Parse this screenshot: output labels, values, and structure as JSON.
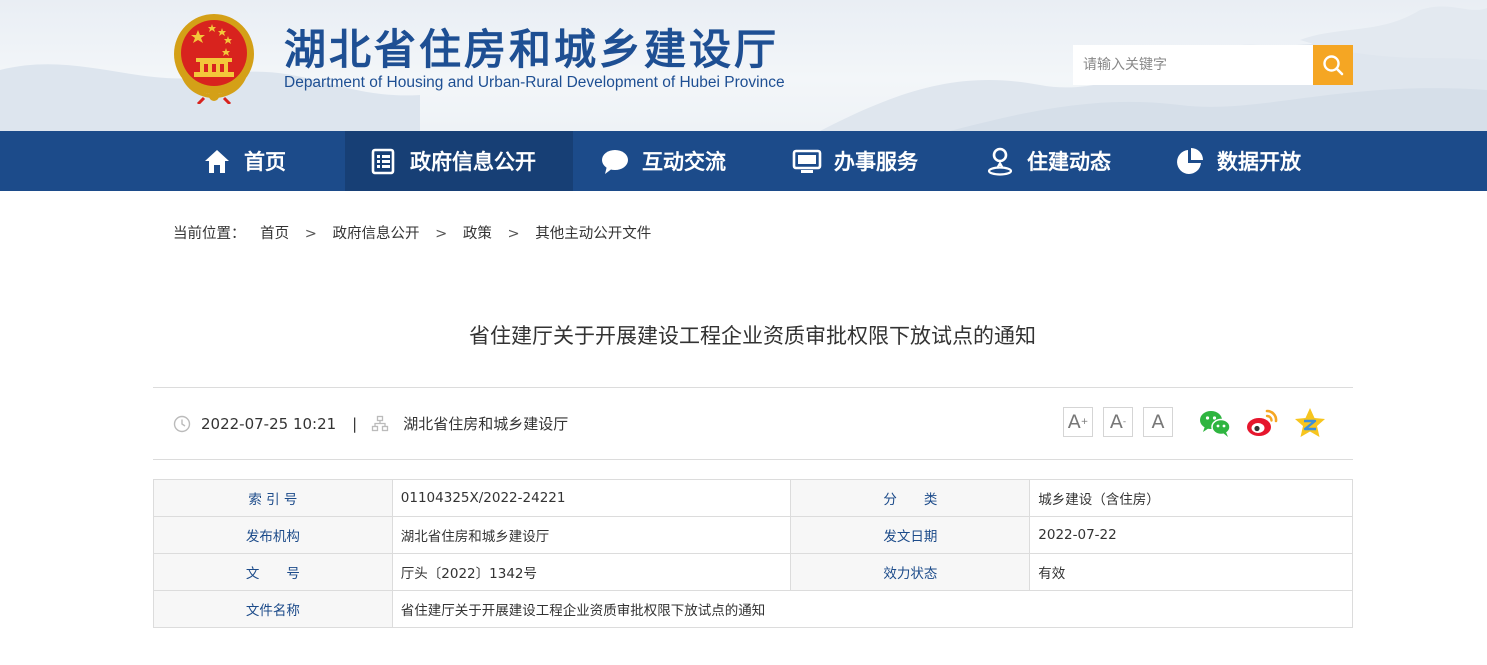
{
  "header": {
    "title": "湖北省住房和城乡建设厅",
    "subtitle": "Department of Housing and Urban-Rural Development of Hubei Province"
  },
  "search": {
    "placeholder": "请输入关键字",
    "icon": "search-icon",
    "button_color": "#f5a623"
  },
  "nav": {
    "items": [
      {
        "label": "首页",
        "icon": "home-icon"
      },
      {
        "label": "政府信息公开",
        "icon": "document-list-icon"
      },
      {
        "label": "互动交流",
        "icon": "chat-bubble-icon"
      },
      {
        "label": "办事服务",
        "icon": "monitor-icon"
      },
      {
        "label": "住建动态",
        "icon": "person-pin-icon"
      },
      {
        "label": "数据开放",
        "icon": "pie-chart-icon"
      }
    ],
    "active_index": 1,
    "bg_color": "#1c4b8a"
  },
  "breadcrumb": {
    "prefix": "当前位置：",
    "items": [
      "首页",
      "政府信息公开",
      "政策",
      "其他主动公开文件"
    ],
    "separator": ">"
  },
  "article": {
    "title": "省住建厅关于开展建设工程企业资质审批权限下放试点的通知",
    "datetime": "2022-07-25 10:21",
    "divider": "|",
    "source": "湖北省住房和城乡建设厅"
  },
  "tools": {
    "font_larger": "A",
    "font_smaller": "A",
    "font_default": "A",
    "plus_mark": "+",
    "minus_mark": "-"
  },
  "share": [
    "wechat-icon",
    "weibo-icon",
    "qzone-icon"
  ],
  "info_table": {
    "row1": {
      "k1": "索 引 号",
      "v1": "01104325X/2022-24221",
      "k2": "分　　类",
      "v2": "城乡建设（含住房）"
    },
    "row2": {
      "k1": "发布机构",
      "v1": "湖北省住房和城乡建设厅",
      "k2": "发文日期",
      "v2": "2022-07-22"
    },
    "row3": {
      "k1": "文　　号",
      "v1": "厅头〔2022〕1342号",
      "k2": "效力状态",
      "v2": "有效"
    },
    "row4": {
      "k1": "文件名称",
      "v1": "省住建厅关于开展建设工程企业资质审批权限下放试点的通知"
    }
  }
}
